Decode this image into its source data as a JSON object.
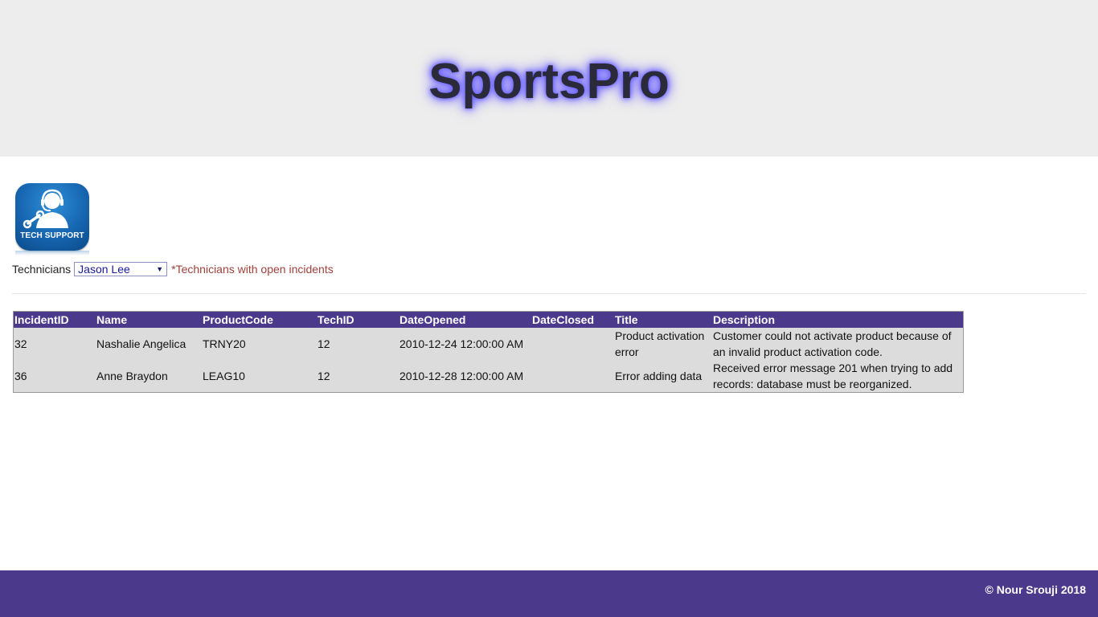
{
  "header": {
    "title": "SportsPro"
  },
  "logo": {
    "text": "TECH SUPPORT",
    "icon": "tech-support-headset-icon"
  },
  "filter": {
    "label": "Technicians",
    "selected": "Jason Lee",
    "note": "*Technicians with open incidents"
  },
  "table": {
    "columns": [
      "IncidentID",
      "Name",
      "ProductCode",
      "TechID",
      "DateOpened",
      "DateClosed",
      "Title",
      "Description"
    ],
    "rows": [
      {
        "IncidentID": "32",
        "Name": "Nashalie Angelica",
        "ProductCode": "TRNY20",
        "TechID": "12",
        "DateOpened": "2010-12-24 12:00:00 AM",
        "DateClosed": "",
        "Title": "Product activation error",
        "Description": "Customer could not activate product because of an invalid product activation code."
      },
      {
        "IncidentID": "36",
        "Name": "Anne Braydon",
        "ProductCode": "LEAG10",
        "TechID": "12",
        "DateOpened": "2010-12-28 12:00:00 AM",
        "DateClosed": "",
        "Title": "Error adding data",
        "Description": "Received error message 201 when trying to add records: database must be reorganized."
      }
    ]
  },
  "footer": {
    "text": "© Nour Srouji 2018"
  },
  "colors": {
    "brand": "#4b3a8c",
    "banner": "#ededed",
    "note": "#a0403a",
    "row_bg": "#dcdcdc"
  }
}
